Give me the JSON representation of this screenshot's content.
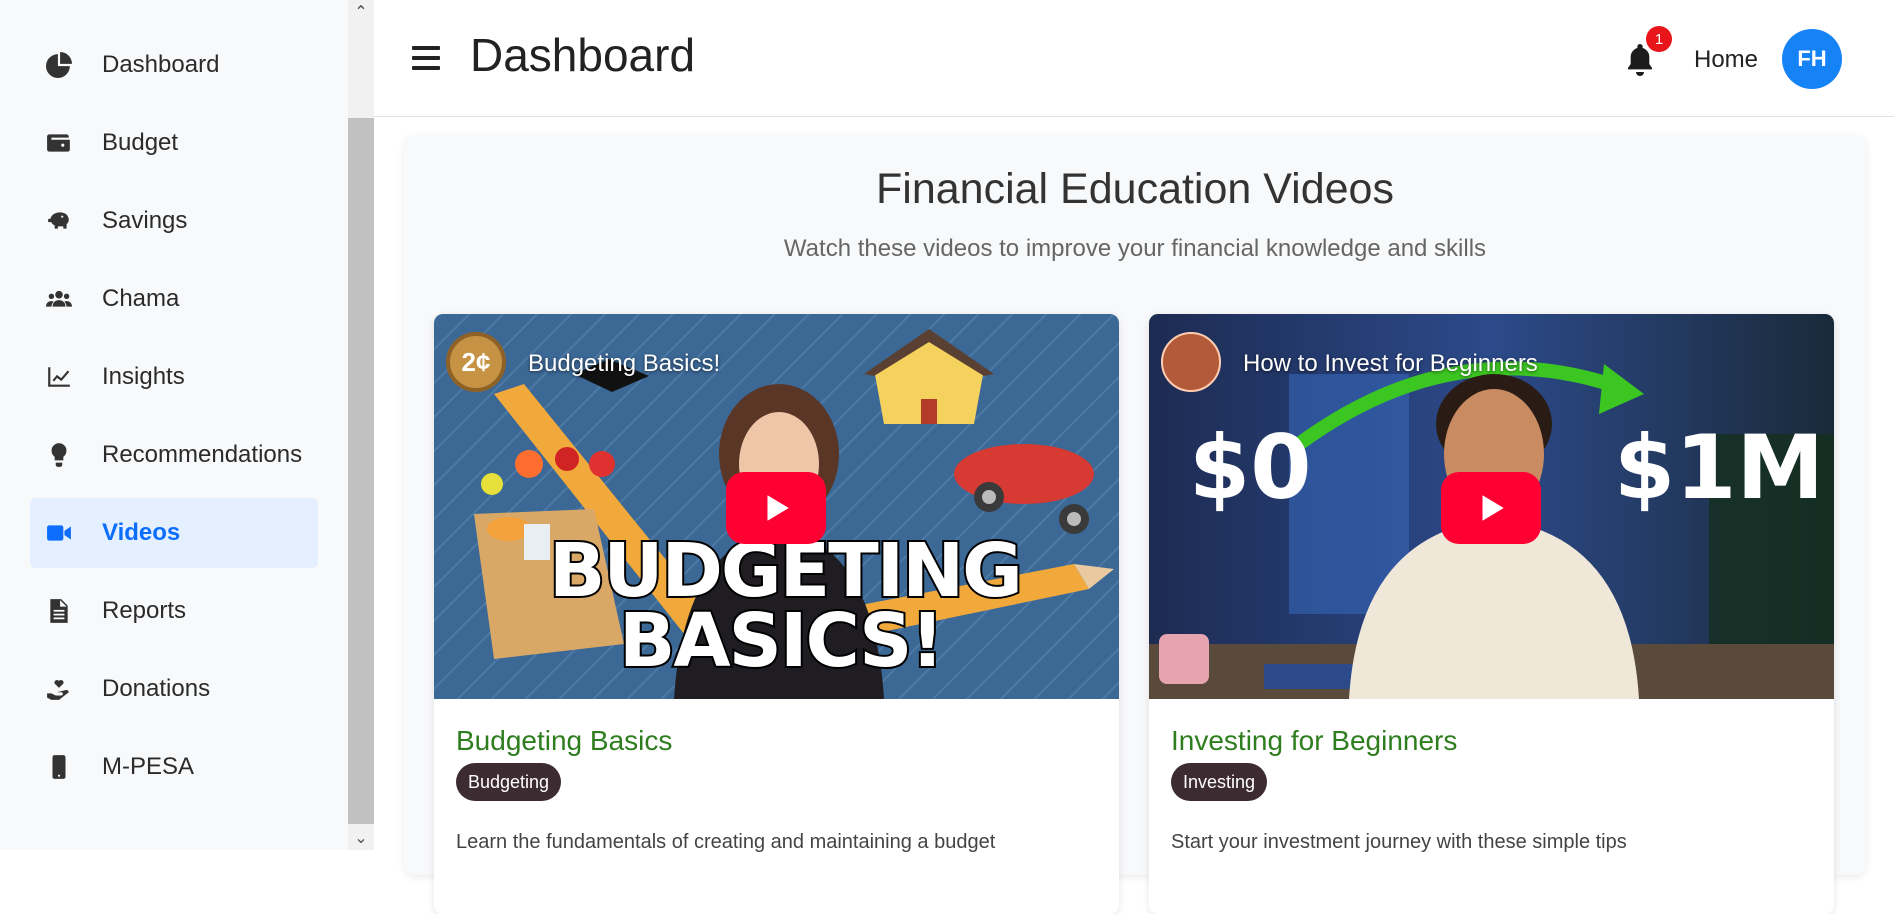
{
  "sidebar": {
    "items": [
      {
        "label": "Dashboard",
        "icon": "chart-pie-icon"
      },
      {
        "label": "Budget",
        "icon": "wallet-icon"
      },
      {
        "label": "Savings",
        "icon": "piggy-bank-icon"
      },
      {
        "label": "Chama",
        "icon": "users-icon"
      },
      {
        "label": "Insights",
        "icon": "chart-line-icon"
      },
      {
        "label": "Recommendations",
        "icon": "lightbulb-icon"
      },
      {
        "label": "Videos",
        "icon": "video-icon",
        "active": true
      },
      {
        "label": "Reports",
        "icon": "file-icon"
      },
      {
        "label": "Donations",
        "icon": "hand-holding-heart-icon"
      },
      {
        "label": "M-PESA",
        "icon": "mobile-icon"
      }
    ]
  },
  "header": {
    "title": "Dashboard",
    "notification_count": "1",
    "home_label": "Home",
    "avatar_initials": "FH"
  },
  "main": {
    "heading": "Financial Education Videos",
    "subtitle": "Watch these videos to improve your financial knowledge and skills",
    "videos": [
      {
        "video_title": "Budgeting Basics!",
        "overlay_text_1": "BUDGETING",
        "overlay_text_2": "BASICS!",
        "channel_badge": "2¢",
        "title": "Budgeting Basics",
        "tag": "Budgeting",
        "description": "Learn the fundamentals of creating and maintaining a budget"
      },
      {
        "video_title": "How to Invest for Beginners",
        "overlay_left": "$0",
        "overlay_right": "$1M",
        "title": "Investing for Beginners",
        "tag": "Investing",
        "description": "Start your investment journey with these simple tips"
      }
    ]
  },
  "colors": {
    "accent": "#0d6efd",
    "active_bg": "#e4f0ff",
    "avatar": "#1583f5",
    "badge": "#e8161a",
    "card_title": "#2e7d1e",
    "tag_bg": "#3d2b32",
    "play_button": "#ff0033"
  }
}
